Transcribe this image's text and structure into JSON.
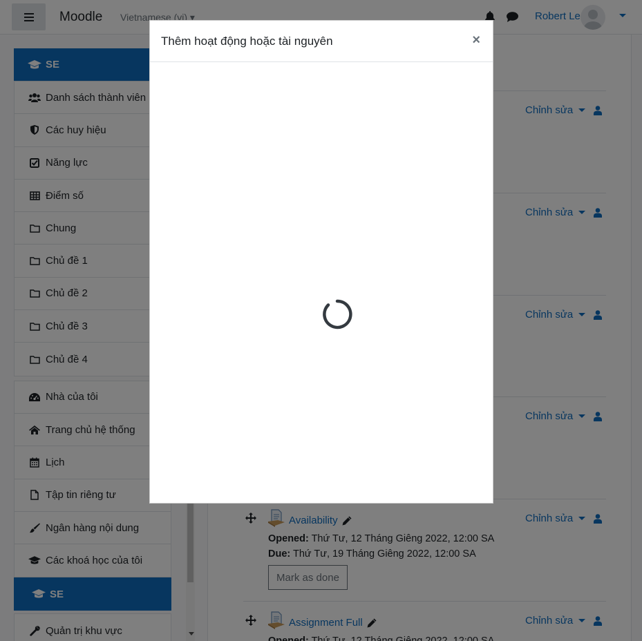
{
  "navbar": {
    "brand": "Moodle",
    "language": "Vietnamese (vi) ▾",
    "user_name": "Robert Le"
  },
  "drawer": {
    "course_header": "SE",
    "course_items": [
      {
        "label": "Danh sách thành viên",
        "icon": "users-icon"
      },
      {
        "label": "Các huy hiệu",
        "icon": "shield-icon"
      },
      {
        "label": "Năng lực",
        "icon": "checkbox-icon"
      },
      {
        "label": "Điểm số",
        "icon": "table-icon"
      },
      {
        "label": "Chung",
        "icon": "folder-icon"
      },
      {
        "label": "Chủ đề 1",
        "icon": "folder-icon"
      },
      {
        "label": "Chủ đề 2",
        "icon": "folder-icon"
      },
      {
        "label": "Chủ đề 3",
        "icon": "folder-icon"
      },
      {
        "label": "Chủ đề 4",
        "icon": "folder-icon"
      }
    ],
    "site_items": [
      {
        "label": "Nhà của tôi",
        "icon": "dashboard-icon"
      },
      {
        "label": "Trang chủ hệ thống",
        "icon": "home-icon"
      },
      {
        "label": "Lịch",
        "icon": "calendar-icon"
      },
      {
        "label": "Tập tin riêng tư",
        "icon": "file-icon"
      },
      {
        "label": "Ngân hàng nội dung",
        "icon": "brush-icon"
      },
      {
        "label": "Các khoá học của tôi",
        "icon": "graduation-cap-icon"
      }
    ],
    "admin_header": "SE",
    "admin_items": [
      {
        "label": "Quản trị khu vực",
        "icon": "wrench-icon"
      }
    ]
  },
  "main": {
    "edit_label": "Chỉnh sửa",
    "activities": [
      {
        "name": "Availability",
        "opened_label": "Opened:",
        "opened_value": " Thứ Tư, 12 Tháng Giêng 2022, 12:00 SA",
        "due_label": "Due:",
        "due_value": " Thứ Tư, 19 Tháng Giêng 2022, 12:00 SA",
        "button": "Mark as done"
      },
      {
        "name": "Assignment Full",
        "opened_label": "Opened:",
        "opened_value": " Thứ Tư, 12 Tháng Giêng 2022, 12:00 SA"
      }
    ]
  },
  "modal": {
    "title": "Thêm hoạt động hoặc tài nguyên",
    "close": "×"
  },
  "colors": {
    "primary": "#0f6cbf",
    "text": "#1d2125",
    "muted": "#6a737b"
  }
}
